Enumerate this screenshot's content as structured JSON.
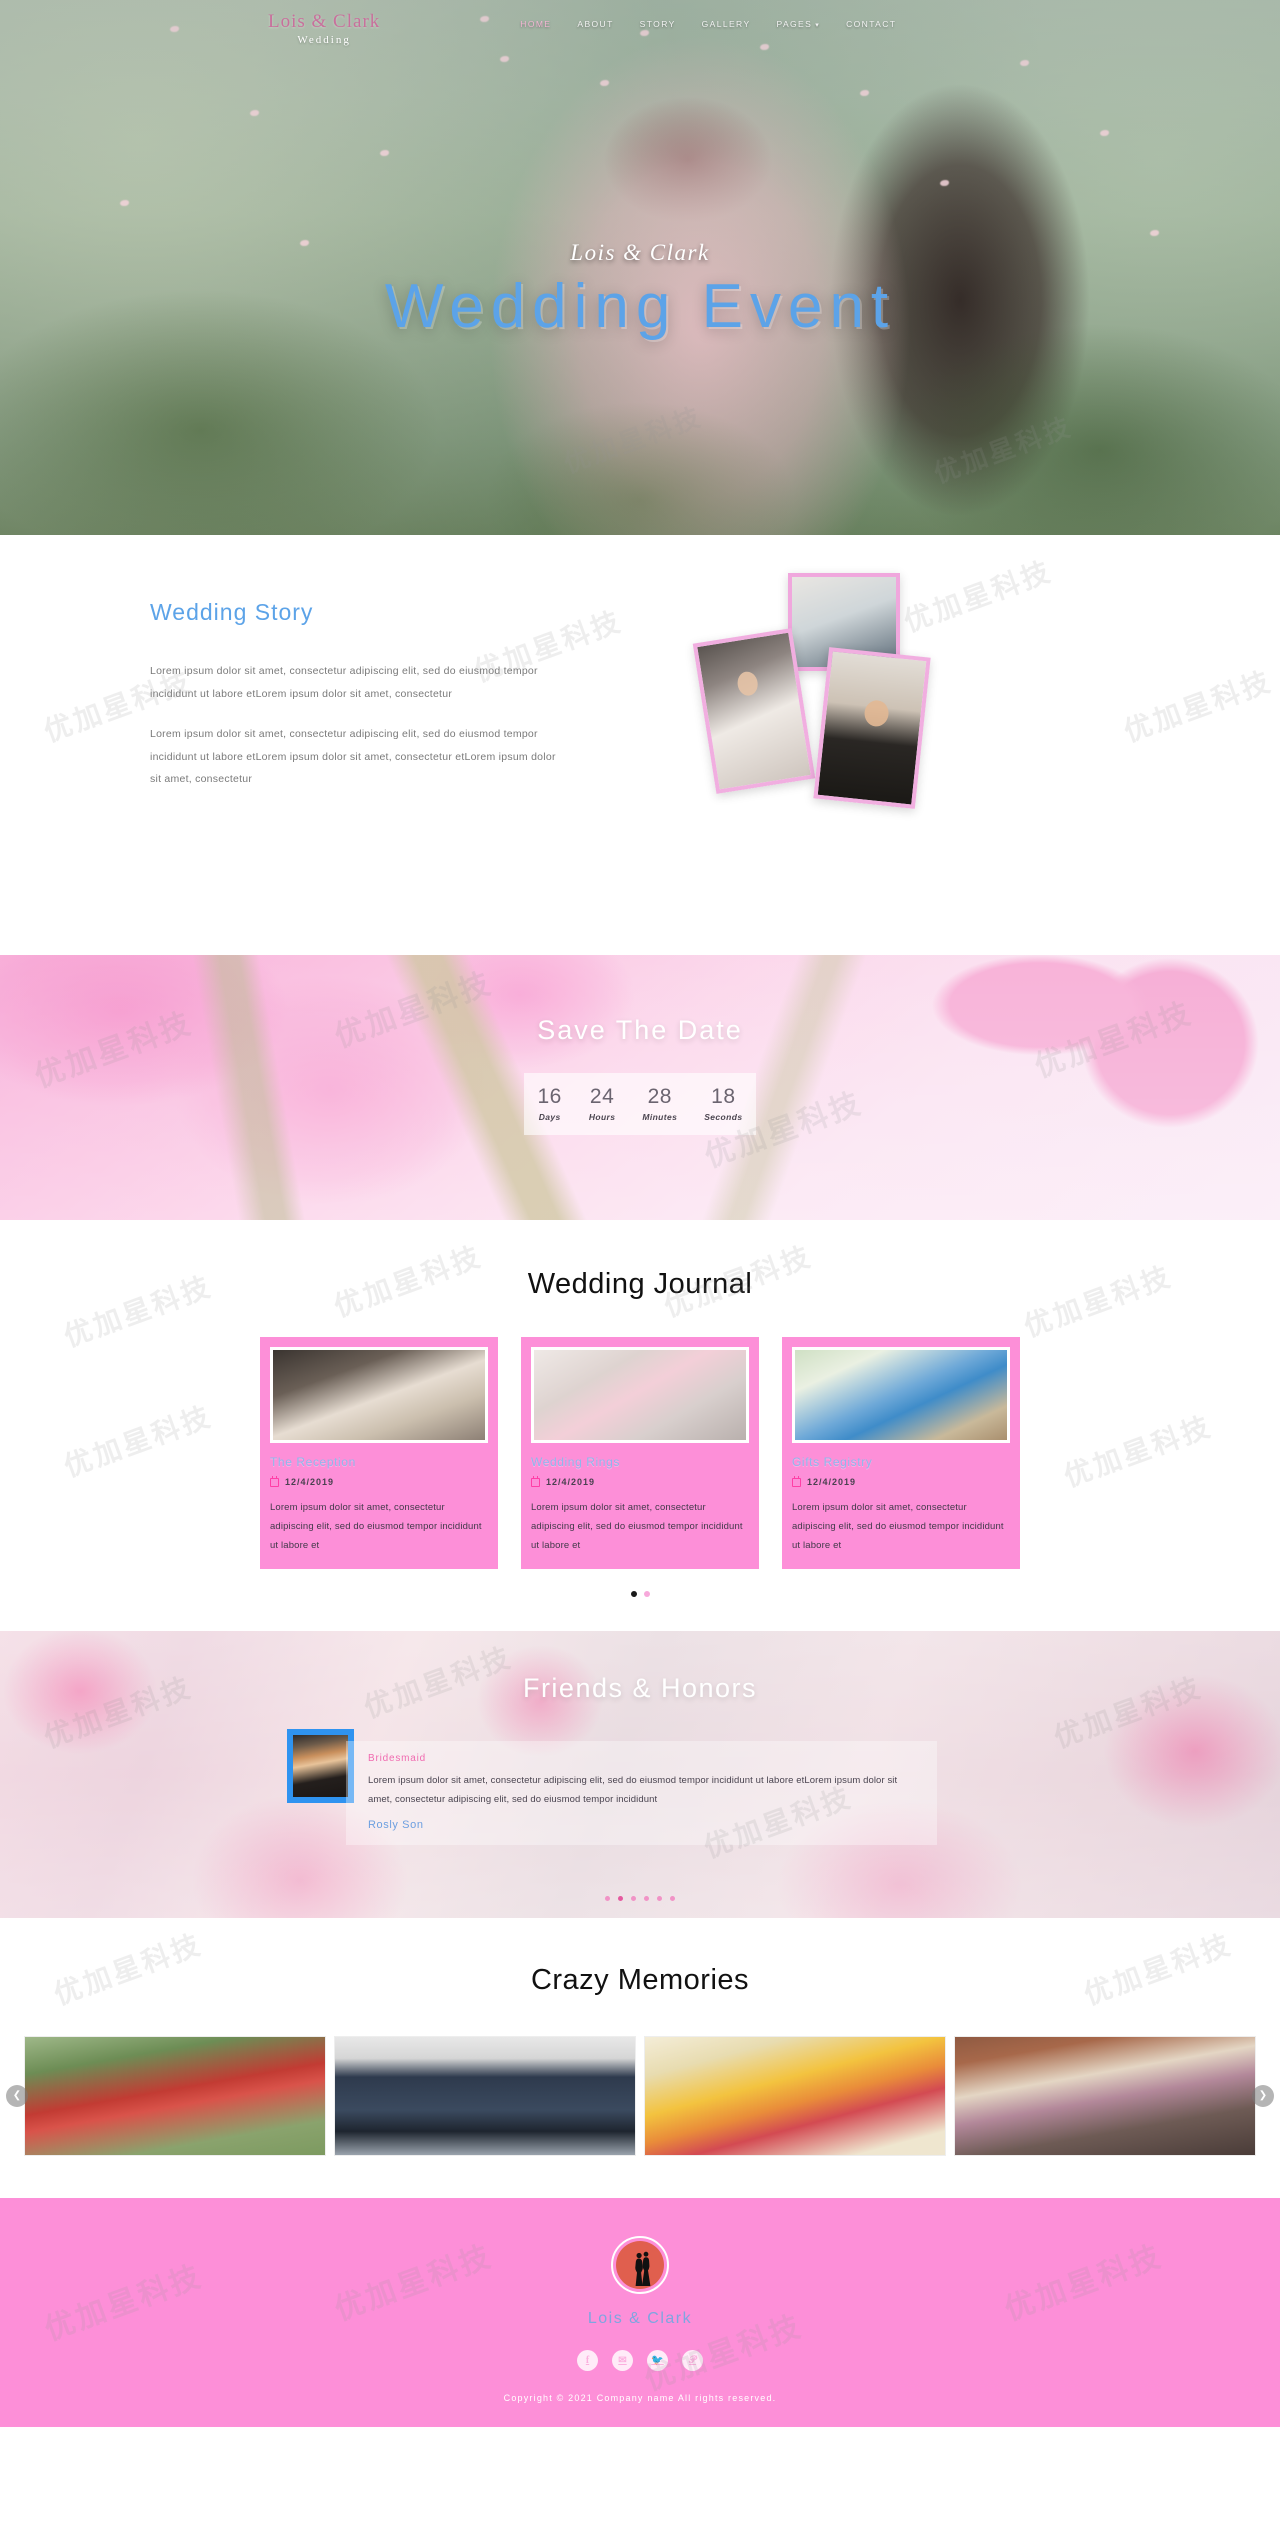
{
  "nav": {
    "brand_name": "Lois & Clark",
    "brand_sub": "Wedding",
    "items": [
      {
        "label": "HOME",
        "active": true,
        "caret": false
      },
      {
        "label": "ABOUT",
        "active": false,
        "caret": false
      },
      {
        "label": "STORY",
        "active": false,
        "caret": false
      },
      {
        "label": "GALLERY",
        "active": false,
        "caret": false
      },
      {
        "label": "PAGES",
        "active": false,
        "caret": true
      },
      {
        "label": "CONTACT",
        "active": false,
        "caret": false
      }
    ],
    "caret_glyph": "▾"
  },
  "hero": {
    "script": "Lois & Clark",
    "title": "Wedding Event",
    "title_color": "#5ca3e8"
  },
  "story": {
    "title": "Wedding Story",
    "paragraph1": "Lorem ipsum dolor sit amet, consectetur adipiscing elit, sed do eiusmod tempor incididunt ut labore etLorem ipsum dolor sit amet, consectetur",
    "paragraph2": "Lorem ipsum dolor sit amet, consectetur adipiscing elit, sed do eiusmod tempor incididunt ut labore etLorem ipsum dolor sit amet, consectetur etLorem ipsum dolor sit amet, consectetur"
  },
  "save_the_date": {
    "title": "Save The Date",
    "counters": [
      {
        "value": "16",
        "label": "Days"
      },
      {
        "value": "24",
        "label": "Hours"
      },
      {
        "value": "28",
        "label": "Minutes"
      },
      {
        "value": "18",
        "label": "Seconds"
      }
    ]
  },
  "journal": {
    "title": "Wedding Journal",
    "cards": [
      {
        "title": "The Reception",
        "date": "12/4/2019",
        "text": "Lorem ipsum dolor sit amet, consectetur adipiscing elit, sed do eiusmod tempor incididunt ut labore et"
      },
      {
        "title": "Wedding Rings",
        "date": "12/4/2019",
        "text": "Lorem ipsum dolor sit amet, consectetur adipiscing elit, sed do eiusmod tempor incididunt ut labore et"
      },
      {
        "title": "Gifts Registry",
        "date": "12/4/2019",
        "text": "Lorem ipsum dolor sit amet, consectetur adipiscing elit, sed do eiusmod tempor incididunt ut labore et"
      }
    ],
    "dots": [
      {
        "active": true
      },
      {
        "active": false
      }
    ],
    "card_bg": "#fd8fd8"
  },
  "friends": {
    "title": "Friends & Honors",
    "role": "Bridesmaid",
    "text": "Lorem ipsum dolor sit amet, consectetur adipiscing elit, sed do eiusmod tempor incididunt ut labore etLorem ipsum dolor sit amet, consectetur adipiscing elit, sed do eiusmod tempor incididunt",
    "name": "Rosly Son",
    "dots": [
      {
        "active": false
      },
      {
        "active": true
      },
      {
        "active": false
      },
      {
        "active": false
      },
      {
        "active": false
      },
      {
        "active": false
      }
    ]
  },
  "memories": {
    "title": "Crazy Memories",
    "prev_glyph": "❮",
    "next_glyph": "❯",
    "items": [
      {
        "alt": "groomsmen-by-red-car"
      },
      {
        "alt": "groomsmen-jumping"
      },
      {
        "alt": "bridesmaids-bouquets"
      },
      {
        "alt": "wedding-party-brick-wall"
      }
    ]
  },
  "footer": {
    "brand": "Lois & Clark",
    "copyright": "Copyright © 2021 Company name All rights reserved.",
    "bg_color": "#fd8fd8",
    "socials": [
      {
        "name": "facebook",
        "glyph": "f"
      },
      {
        "name": "email",
        "glyph": "✉"
      },
      {
        "name": "twitter",
        "glyph": "🐦"
      },
      {
        "name": "pinterest",
        "glyph": "𝒫"
      }
    ]
  },
  "watermark": {
    "text": "优加星科技"
  }
}
